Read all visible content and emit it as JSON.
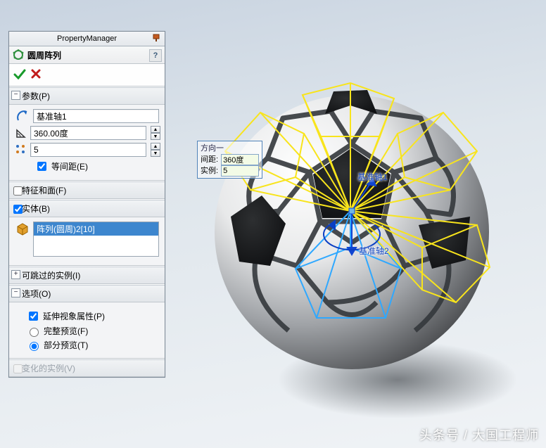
{
  "header": {
    "title": "PropertyManager"
  },
  "feature": {
    "title": "圆周阵列"
  },
  "sections": {
    "params": {
      "title": "参数(P)",
      "axis_value": "基准轴1",
      "angle_value": "360.00度",
      "instances_value": "5",
      "equal_spacing_label": "等间距(E)"
    },
    "seed": {
      "title": "特征和面(F)"
    },
    "bodies": {
      "title": "实体(B)",
      "selected_item": "阵列(圆周)2[10]"
    },
    "instances_to_skip": {
      "title": "可跳过的实例(I)"
    },
    "options": {
      "title": "选项(O)",
      "propagate_label": "延伸视象属性(P)",
      "full_preview_label": "完整预览(F)",
      "partial_preview_label": "部分预览(T)"
    },
    "varied": {
      "title": "变化的实例(V)"
    }
  },
  "callout": {
    "direction_label": "方向一",
    "spacing_label": "间距:",
    "spacing_value": "360度",
    "instances_label": "实例:",
    "instances_value": "5"
  },
  "viewport": {
    "axis1_label": "基准轴1",
    "axis2_label": "基准轴2"
  },
  "watermark": "头条号 / 大国工程师"
}
